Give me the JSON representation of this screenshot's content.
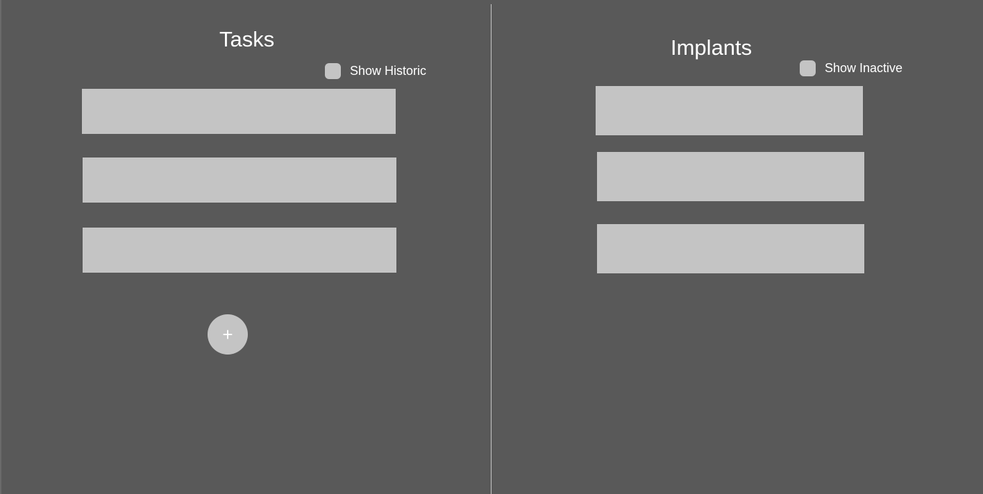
{
  "tasks": {
    "title": "Tasks",
    "toggle_label": "Show Historic",
    "toggle_checked": false,
    "items": [
      "",
      "",
      ""
    ],
    "add_icon_glyph": "+",
    "add_icon_name": "plus-icon"
  },
  "implants": {
    "title": "Implants",
    "toggle_label": "Show Inactive",
    "toggle_checked": false,
    "items": [
      "",
      "",
      ""
    ]
  },
  "colors": {
    "background": "#595959",
    "item_fill": "#c4c4c4",
    "text": "#ffffff",
    "divider": "#c8c8c8"
  }
}
